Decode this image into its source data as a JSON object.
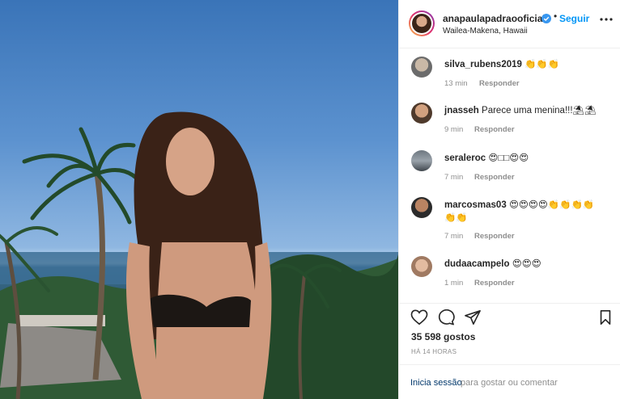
{
  "post": {
    "username": "anapaulapadraooficial",
    "follow_label": "Seguir",
    "separator": "•",
    "location": "Wailea-Makena, Hawaii"
  },
  "comments": [
    {
      "user": "silva_rubens2019",
      "text": "👏👏👏",
      "time": "13 min",
      "reply": "Responder"
    },
    {
      "user": "jnasseh",
      "text": "Parece uma menina!!!⛱⛱",
      "time": "9 min",
      "reply": "Responder"
    },
    {
      "user": "seraleroc",
      "text": "😍□□😍😍",
      "time": "7 min",
      "reply": "Responder"
    },
    {
      "user": "marcosmas03",
      "text": "😍😍😍😍👏👏👏👏",
      "text2": "👏👏",
      "time": "7 min",
      "reply": "Responder"
    },
    {
      "user": "dudaacampelo",
      "text": "😍😍😍",
      "time": "1 min",
      "reply": "Responder"
    }
  ],
  "stats": {
    "likes": "35 598 gostos",
    "time_ago": "HÁ 14 HORAS"
  },
  "footer": {
    "login_link": "Inicia sessão",
    "login_text": "para gostar ou comentar"
  },
  "icons": {
    "like": "heart-icon",
    "comment": "comment-icon",
    "share": "share-icon",
    "save": "bookmark-icon",
    "more": "more-options-icon",
    "verified": "verified-badge-icon"
  },
  "colors": {
    "accent": "#0095f6",
    "muted": "#8e8e8e",
    "text": "#262626",
    "verified": "#3897f0"
  }
}
